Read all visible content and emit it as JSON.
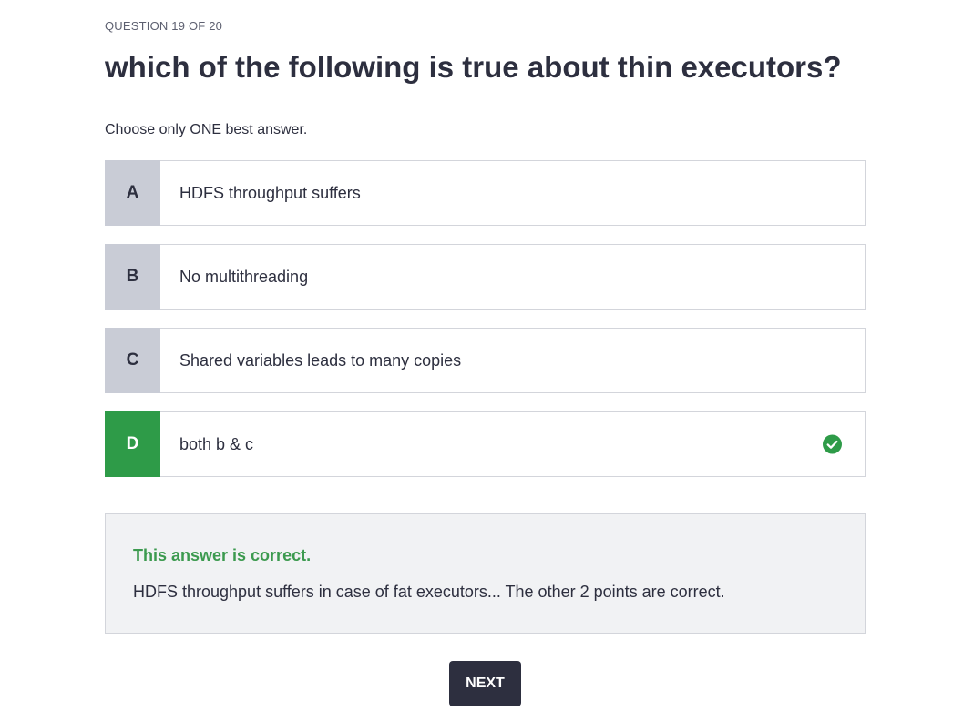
{
  "quiz": {
    "counter": "QUESTION 19 OF 20",
    "question": "which of the following is true about thin executors?",
    "instruction": "Choose only ONE best answer.",
    "options": [
      {
        "letter": "A",
        "text": "HDFS throughput suffers"
      },
      {
        "letter": "B",
        "text": "No multithreading"
      },
      {
        "letter": "C",
        "text": "Shared variables leads to many copies"
      },
      {
        "letter": "D",
        "text": "both b & c"
      }
    ],
    "selected_correct_option": "D",
    "feedback": {
      "title": "This answer is correct.",
      "explanation": "HDFS throughput suffers in case of fat executors... The other 2 points are correct."
    },
    "next_label": "NEXT"
  },
  "colors": {
    "correct_green": "#2e9b48",
    "letter_gray": "#c9ccd6",
    "dark": "#2d2f3f",
    "feedback_bg": "#f1f2f4"
  },
  "icons": {
    "correct_check": "check-circle-icon"
  }
}
